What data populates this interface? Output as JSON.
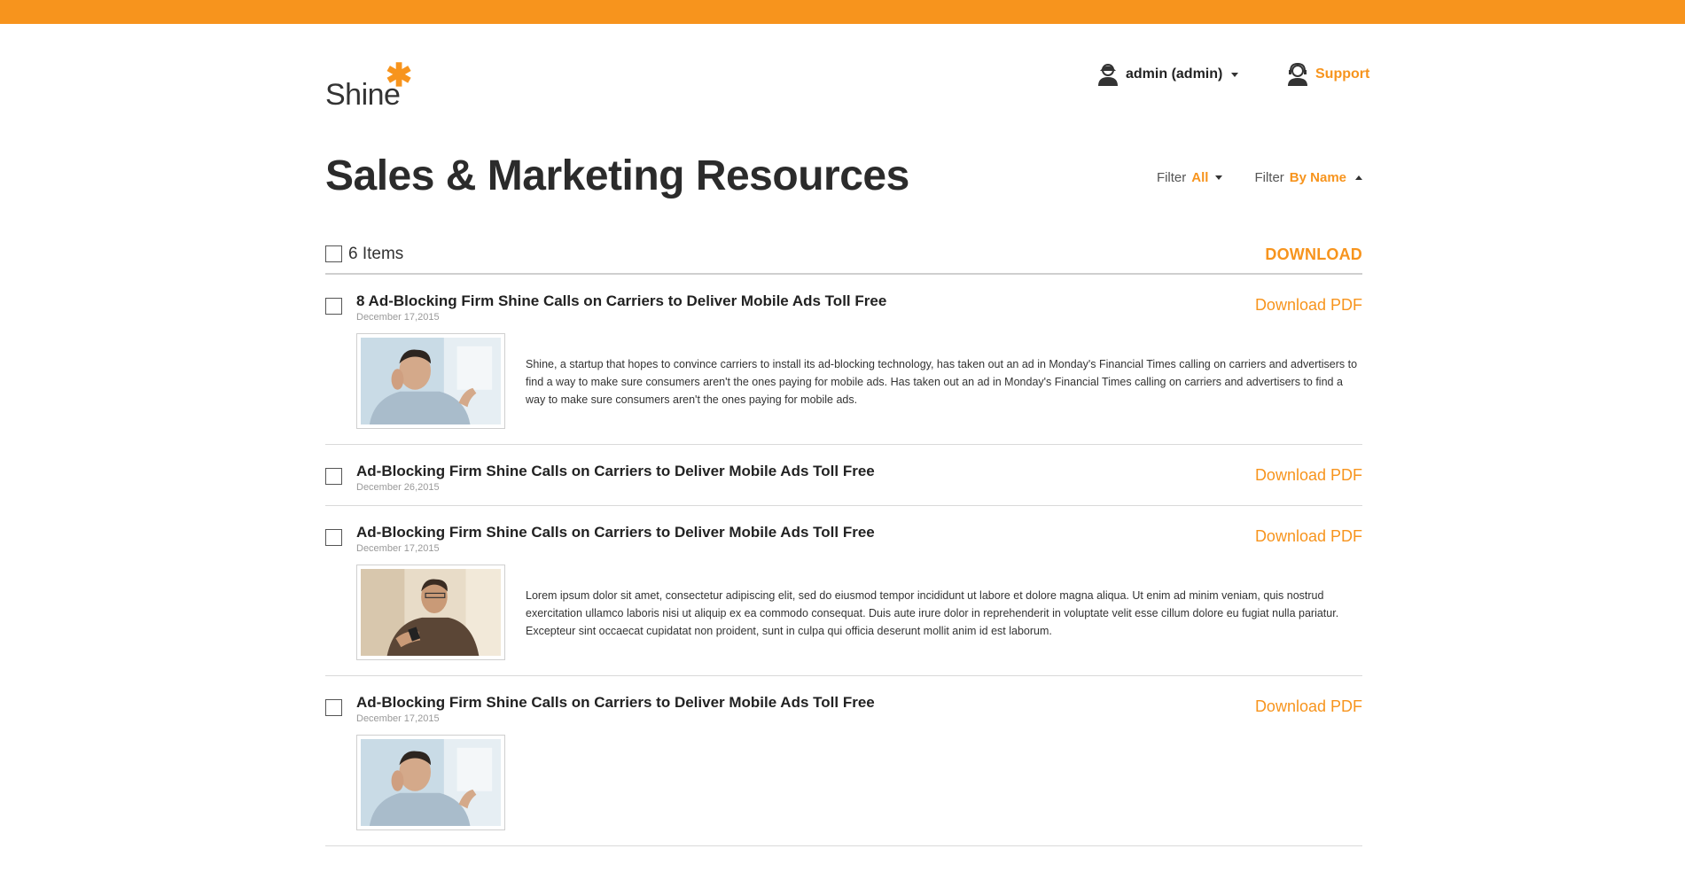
{
  "brand": {
    "name": "Shine",
    "accent": "#f7941d"
  },
  "header": {
    "user_label": "admin (admin)",
    "support_label": "Support"
  },
  "page": {
    "title": "Sales & Marketing Resources",
    "filters": [
      {
        "label": "Filter",
        "value": "All"
      },
      {
        "label": "Filter",
        "value": "By Name"
      }
    ]
  },
  "list": {
    "count_label": "6 Items",
    "download_label": "DOWNLOAD",
    "rows": [
      {
        "title": "8 Ad-Blocking Firm Shine Calls on Carriers to Deliver Mobile Ads Toll Free",
        "date": "December 17,2015",
        "download": "Download PDF",
        "description": "Shine, a startup that hopes to convince carriers to install its ad-blocking technology, has taken out an ad in Monday's Financial Times calling on carriers and advertisers to find a way to make sure consumers aren't the ones paying for mobile ads. Has taken out an ad in Monday's Financial Times calling on carriers and advertisers to find a way to make sure consumers aren't the ones paying for mobile ads."
      },
      {
        "title": "Ad-Blocking Firm Shine Calls on Carriers to Deliver Mobile Ads Toll Free",
        "date": "December 26,2015",
        "download": "Download PDF"
      },
      {
        "title": "Ad-Blocking Firm Shine Calls on Carriers to Deliver Mobile Ads Toll Free",
        "date": "December 17,2015",
        "download": "Download PDF",
        "description": "Lorem ipsum dolor sit amet, consectetur adipiscing elit, sed do eiusmod tempor incididunt ut labore et dolore magna aliqua. Ut enim ad minim veniam, quis nostrud exercitation ullamco laboris nisi ut aliquip ex ea commodo consequat. Duis aute irure dolor in reprehenderit in voluptate velit esse cillum dolore eu fugiat nulla pariatur. Excepteur sint occaecat cupidatat non proident, sunt in culpa qui officia deserunt mollit anim id est laborum."
      },
      {
        "title": "Ad-Blocking Firm Shine Calls on Carriers to Deliver Mobile Ads Toll Free",
        "date": "December 17,2015",
        "download": "Download PDF"
      }
    ]
  }
}
